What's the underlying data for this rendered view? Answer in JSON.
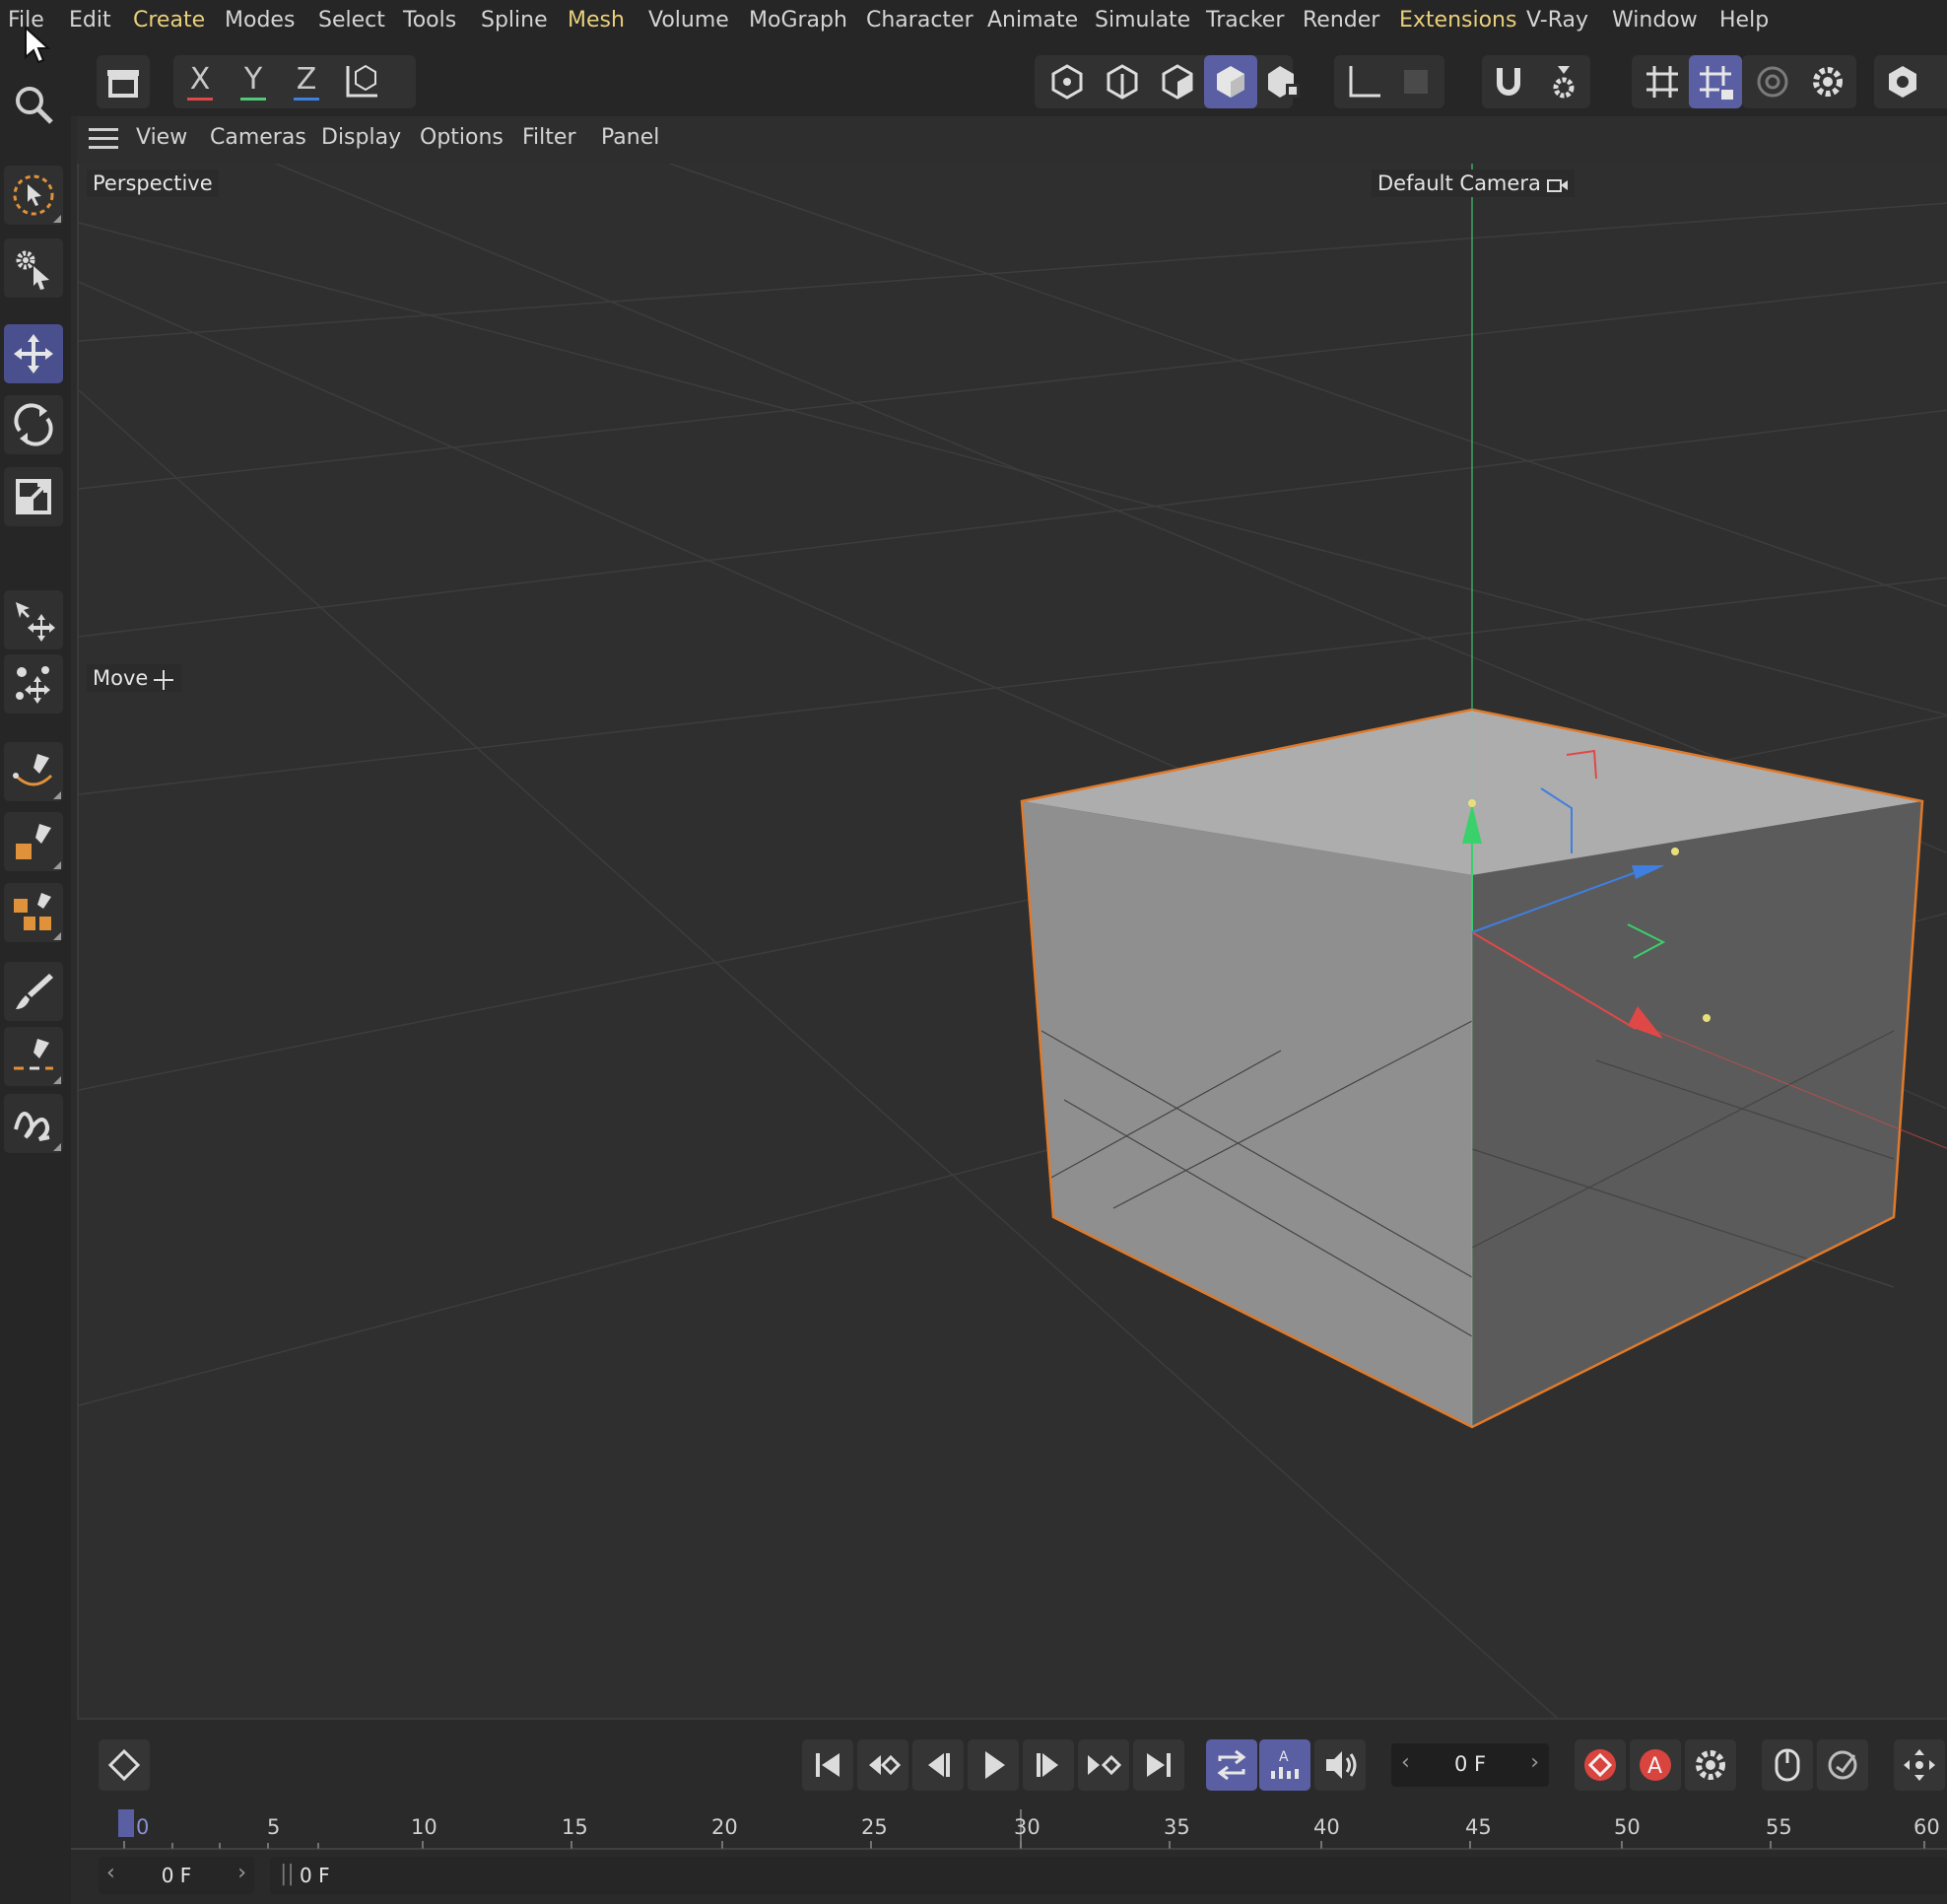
{
  "menu": {
    "items": [
      {
        "label": "File",
        "highlight": false
      },
      {
        "label": "Edit",
        "highlight": false
      },
      {
        "label": "Create",
        "highlight": true
      },
      {
        "label": "Modes",
        "highlight": false
      },
      {
        "label": "Select",
        "highlight": false
      },
      {
        "label": "Tools",
        "highlight": false
      },
      {
        "label": "Spline",
        "highlight": false
      },
      {
        "label": "Mesh",
        "highlight": true
      },
      {
        "label": "Volume",
        "highlight": false
      },
      {
        "label": "MoGraph",
        "highlight": false
      },
      {
        "label": "Character",
        "highlight": false
      },
      {
        "label": "Animate",
        "highlight": false
      },
      {
        "label": "Simulate",
        "highlight": false
      },
      {
        "label": "Tracker",
        "highlight": false
      },
      {
        "label": "Render",
        "highlight": false
      },
      {
        "label": "Extensions",
        "highlight": true
      },
      {
        "label": "V-Ray",
        "highlight": false
      },
      {
        "label": "Window",
        "highlight": false
      },
      {
        "label": "Help",
        "highlight": false
      }
    ]
  },
  "toolbar": {
    "axis_x": "X",
    "axis_y": "Y",
    "axis_z": "Z",
    "colors": {
      "x": "#e04848",
      "y": "#4fc97a",
      "z": "#3f7fe0",
      "active": "#5a5fa3"
    }
  },
  "viewport_menu": {
    "items": [
      "View",
      "Cameras",
      "Display",
      "Options",
      "Filter",
      "Panel"
    ]
  },
  "viewport": {
    "view_name": "Perspective",
    "camera_name": "Default Camera",
    "tool_hint": "Move",
    "selection_color": "#e07a2a"
  },
  "timeline": {
    "current_frame": "0 F",
    "start_frame": "0 F",
    "frame_display": "0 F",
    "ruler_ticks": [
      "0",
      "5",
      "10",
      "15",
      "20",
      "25",
      "30",
      "35",
      "40",
      "45",
      "50",
      "55",
      "60"
    ]
  }
}
